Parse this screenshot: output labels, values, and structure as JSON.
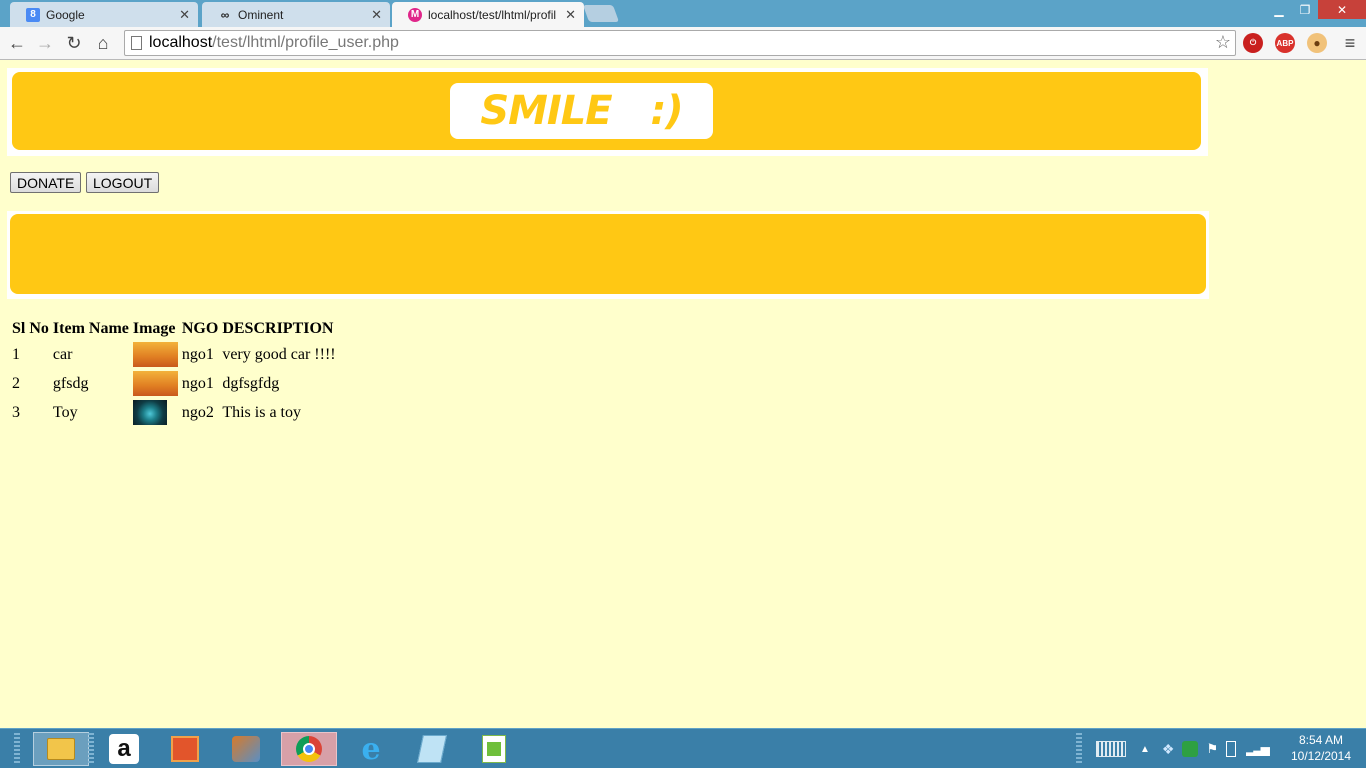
{
  "browser": {
    "tabs": [
      {
        "title": "Google",
        "favicon": "google-icon",
        "active": false
      },
      {
        "title": "Ominent",
        "favicon": "ominent-icon",
        "active": false
      },
      {
        "title": "localhost/test/lhtml/profil",
        "favicon": "moodle-icon",
        "active": true
      }
    ],
    "url": {
      "host": "localhost",
      "path": "/test/lhtml/profile_user.php"
    },
    "extensions": [
      "adblock-stop-icon",
      "abp-icon",
      "cookie-icon"
    ],
    "ext_labels": {
      "abp": "ABP"
    }
  },
  "page": {
    "logo_text": "SMILE   :)",
    "buttons": {
      "donate": "DONATE",
      "logout": "LOGOUT"
    },
    "table": {
      "headers": [
        "Sl No",
        "Item Name",
        "Image",
        "NGO",
        "DESCRIPTION"
      ],
      "rows": [
        {
          "sl": "1",
          "item": "car",
          "image": "warm-orange-thumbnail",
          "ngo": "ngo1",
          "description": "very good car !!!!"
        },
        {
          "sl": "2",
          "item": "gfsdg",
          "image": "warm-orange-thumbnail",
          "ngo": "ngo1",
          "description": "dgfsgfdg"
        },
        {
          "sl": "3",
          "item": "Toy",
          "image": "teal-toy-thumbnail",
          "ngo": "ngo2",
          "description": "This is a toy"
        }
      ]
    },
    "colors": {
      "background": "#ffffcc",
      "banner": "#ffc814"
    }
  },
  "taskbar": {
    "apps": [
      "file-explorer-icon",
      "amazon-icon",
      "office-icon",
      "media-player-icon",
      "chrome-icon",
      "internet-explorer-icon",
      "notepad-icon",
      "notepad-plus-icon"
    ],
    "amazon_label": "a",
    "clock": {
      "time": "8:54 AM",
      "date": "10/12/2014"
    }
  }
}
